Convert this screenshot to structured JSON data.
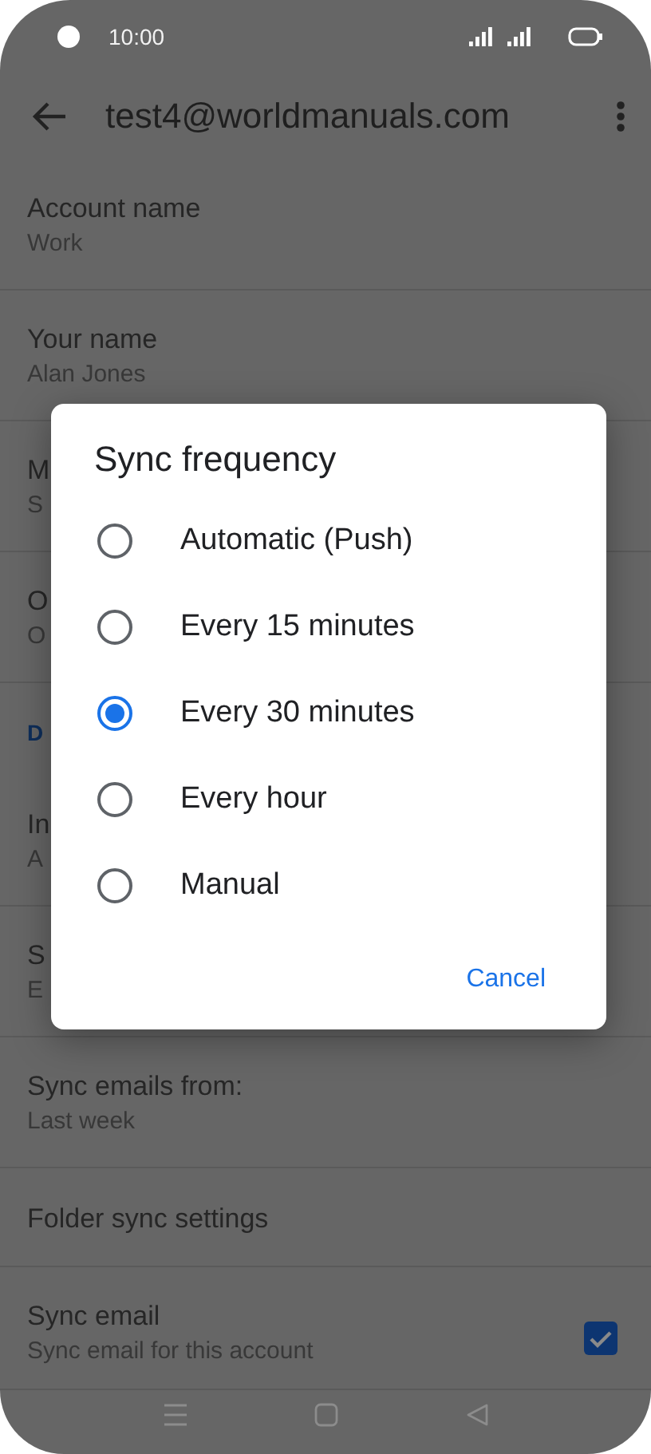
{
  "status_bar": {
    "time": "10:00"
  },
  "toolbar": {
    "title": "test4@worldmanuals.com"
  },
  "settings": [
    {
      "kind": "item",
      "title": "Account name",
      "subtitle": "Work"
    },
    {
      "kind": "item",
      "title": "Your name",
      "subtitle": "Alan Jones"
    },
    {
      "kind": "item",
      "title": "M",
      "subtitle": "S"
    },
    {
      "kind": "item",
      "title": "O",
      "subtitle": "O"
    },
    {
      "kind": "header",
      "title": "D"
    },
    {
      "kind": "item",
      "title": "In",
      "subtitle": "A"
    },
    {
      "kind": "item",
      "title": "S",
      "subtitle": "E"
    },
    {
      "kind": "item",
      "title": "Sync emails from:",
      "subtitle": "Last week"
    },
    {
      "kind": "item",
      "title": "Folder sync settings"
    },
    {
      "kind": "checkbox",
      "title": "Sync email",
      "subtitle": "Sync email for this account",
      "checked": true
    }
  ],
  "dialog": {
    "title": "Sync frequency",
    "options": [
      {
        "label": "Automatic (Push)",
        "selected": false
      },
      {
        "label": "Every 15 minutes",
        "selected": false
      },
      {
        "label": "Every 30 minutes",
        "selected": true
      },
      {
        "label": "Every hour",
        "selected": false
      },
      {
        "label": "Manual",
        "selected": false
      }
    ],
    "buttons": [
      "Cancel"
    ]
  }
}
